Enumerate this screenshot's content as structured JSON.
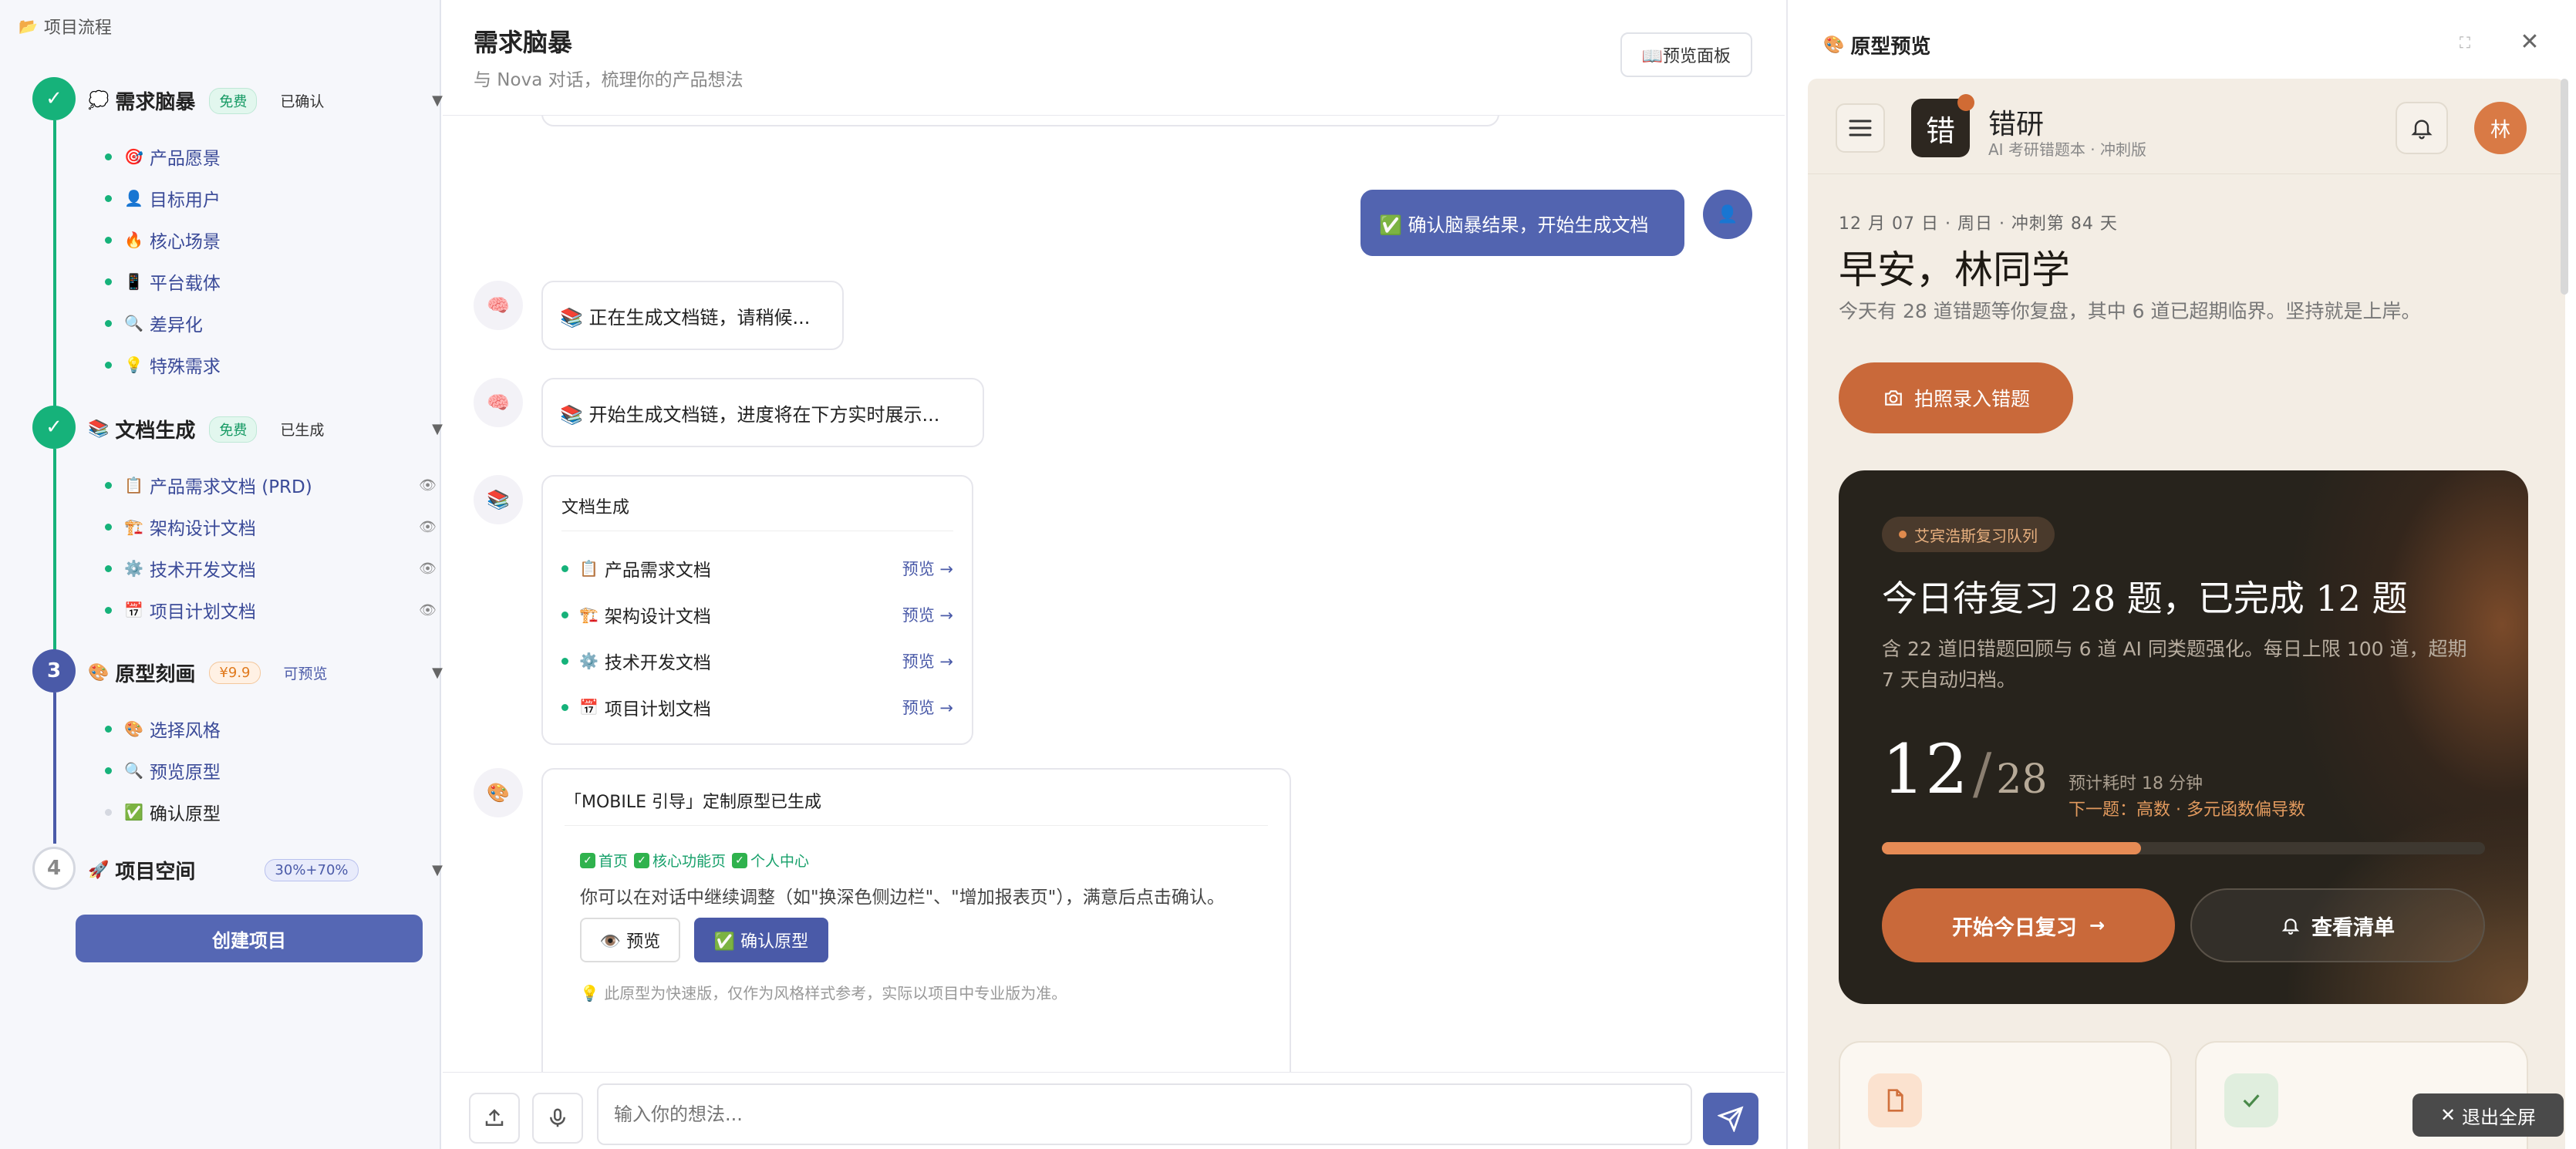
{
  "sidebar": {
    "header": "项目流程",
    "header_icon": "📂",
    "stages": [
      {
        "number": "✓",
        "icon": "💭",
        "title": "需求脑暴",
        "badge": "免费",
        "state": "已确认",
        "items": [
          {
            "icon": "🎯",
            "label": "产品愿景"
          },
          {
            "icon": "👤",
            "label": "目标用户"
          },
          {
            "icon": "🔥",
            "label": "核心场景"
          },
          {
            "icon": "📱",
            "label": "平台载体"
          },
          {
            "icon": "🔍",
            "label": "差异化"
          },
          {
            "icon": "💡",
            "label": "特殊需求"
          }
        ]
      },
      {
        "number": "✓",
        "icon": "📚",
        "title": "文档生成",
        "badge": "免费",
        "state": "已生成",
        "items": [
          {
            "icon": "📋",
            "label": "产品需求文档 (PRD)"
          },
          {
            "icon": "🏗️",
            "label": "架构设计文档"
          },
          {
            "icon": "⚙️",
            "label": "技术开发文档"
          },
          {
            "icon": "📅",
            "label": "项目计划文档"
          }
        ]
      },
      {
        "number": "3",
        "icon": "🎨",
        "title": "原型刻画",
        "badge": "¥9.9",
        "state": "可预览",
        "items": [
          {
            "icon": "🎨",
            "label": "选择风格"
          },
          {
            "icon": "🔍",
            "label": "预览原型"
          },
          {
            "icon": "✅",
            "label": "确认原型"
          }
        ]
      },
      {
        "number": "4",
        "icon": "🚀",
        "title": "项目空间",
        "badge": "30%+70%",
        "state": ""
      }
    ],
    "create_button": "创建项目"
  },
  "chat": {
    "title": "需求脑暴",
    "subtitle": "与 Nova 对话，梳理你的产品想法",
    "preview_panel_button": "📖预览面板",
    "user_message": "✅ 确认脑暴结果，开始生成文档",
    "bot_messages": [
      "📚 正在生成文档链，请稍候...",
      "📚 开始生成文档链，进度将在下方实时展示..."
    ],
    "doc_card": {
      "title": "文档生成",
      "rows": [
        {
          "icon": "📋",
          "label": "产品需求文档",
          "link": "预览 →"
        },
        {
          "icon": "🏗️",
          "label": "架构设计文档",
          "link": "预览 →"
        },
        {
          "icon": "⚙️",
          "label": "技术开发文档",
          "link": "预览 →"
        },
        {
          "icon": "📅",
          "label": "项目计划文档",
          "link": "预览 →"
        }
      ]
    },
    "proto_card": {
      "title": "「MOBILE 引导」定制原型已生成",
      "checks": [
        "首页",
        "核心功能页",
        "个人中心"
      ],
      "desc": "你可以在对话中继续调整（如\"换深色侧边栏\"、\"增加报表页\"），满意后点击确认。",
      "preview_btn": "👁️ 预览",
      "confirm_btn": "✅ 确认原型",
      "note": "💡 此原型为快速版，仅作为风格样式参考，实际以项目中专业版为准。"
    },
    "input_placeholder": "输入你的想法..."
  },
  "preview": {
    "title": "原型预览",
    "title_icon": "🎨",
    "app": {
      "logo_char": "错",
      "name": "错研",
      "subtitle": "AI 考研错题本 · 冲刺版",
      "avatar": "林",
      "date": "12 月 07 日 · 周日 · 冲刺第 84 天",
      "greeting": "早安，林同学",
      "intro": "今天有 28 道错题等你复盘，其中 6 道已超期临界。坚持就是上岸。",
      "camera_button": "拍照录入错题",
      "card": {
        "pill": "艾宾浩斯复习队列",
        "title": "今日待复习 28 题，已完成 12 题",
        "desc": "含 22 道旧错题回顾与 6 道 AI 同类题强化。每日上限 100 道，超期 7 天自动归档。",
        "done": "12",
        "total": "28",
        "progress": 0.43,
        "eta": "预计耗时 18 分钟",
        "next": "下一题：高数 · 多元函数偏导数",
        "start_button": "开始今日复习",
        "list_button": "查看清单"
      }
    },
    "exit_fullscreen": "退出全屏"
  }
}
